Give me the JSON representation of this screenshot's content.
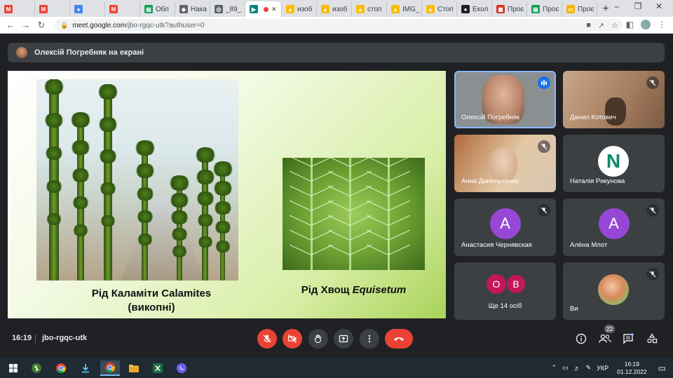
{
  "browser": {
    "tabs": [
      {
        "label": "",
        "favicon": "gmail-icon",
        "color": "#ea4335"
      },
      {
        "label": "",
        "favicon": "gmail-icon",
        "color": "#ea4335"
      },
      {
        "label": "",
        "favicon": "chrome-icon",
        "color": "#4285f4"
      },
      {
        "label": "",
        "favicon": "gmail-icon",
        "color": "#ea4335"
      },
      {
        "label": "Обл",
        "favicon": "sheets-icon",
        "color": "#0f9d58"
      },
      {
        "label": "Нака",
        "favicon": "shield-icon",
        "color": "#5f6368"
      },
      {
        "label": "_89_",
        "favicon": "globe-icon",
        "color": "#5f6368"
      },
      {
        "label": "",
        "favicon": "meet-icon",
        "color": "#00897b"
      },
      {
        "label": "изоб",
        "favicon": "drive-icon",
        "color": "#fbbc04"
      },
      {
        "label": "изоб",
        "favicon": "drive-icon",
        "color": "#fbbc04"
      },
      {
        "label": "стоп",
        "favicon": "drive-icon",
        "color": "#fbbc04"
      },
      {
        "label": "IMG_",
        "favicon": "drive-icon",
        "color": "#fbbc04"
      },
      {
        "label": "Стоп",
        "favicon": "drive-icon",
        "color": "#fbbc04"
      },
      {
        "label": "Екол",
        "favicon": "app-icon",
        "color": "#202124"
      },
      {
        "label": "Проє",
        "favicon": "forms-icon",
        "color": "#d93025"
      },
      {
        "label": "Проє",
        "favicon": "sheets-icon",
        "color": "#0f9d58"
      },
      {
        "label": "Проє",
        "favicon": "slides-icon",
        "color": "#f4b400"
      }
    ],
    "url_host": "meet.google.com",
    "url_path": "/jbo-rgqc-utk?authuser=0"
  },
  "presenter_bar": {
    "text": "Олексій Погребняк на екрані"
  },
  "slide": {
    "caption_left_line1": "Рід Каламіти Calamites",
    "caption_left_line2": "(викопні)",
    "caption_right_prefix": "Рід Хвощ ",
    "caption_right_latin": "Equisetum"
  },
  "participants": [
    {
      "name": "Олексій Погребняк",
      "type": "video",
      "speaking": true
    },
    {
      "name": "Данил Котович",
      "type": "video",
      "muted": true
    },
    {
      "name": "Анна Данильченко",
      "type": "video",
      "muted": true
    },
    {
      "name": "Наталія Рикунова",
      "type": "logo",
      "logo_letter": "N"
    },
    {
      "name": "Анастасия Чернявская",
      "type": "avatar",
      "letter": "A",
      "muted": true
    },
    {
      "name": "Алёна Млот",
      "type": "avatar",
      "letter": "A",
      "muted": true
    },
    {
      "name": "Ще 14 осіб",
      "type": "more",
      "letters": [
        "O",
        "B"
      ]
    },
    {
      "name": "Ви",
      "type": "photo",
      "muted": true
    }
  ],
  "meeting": {
    "time": "16:19",
    "code": "jbo-rgqc-utk",
    "participant_count": "22"
  },
  "taskbar": {
    "lang": "УКР",
    "time": "16:19",
    "date": "01.12.2022"
  },
  "colors": {
    "accent": "#8ab4f8",
    "danger": "#ea4335",
    "avatar_purple": "#9747d6",
    "avatar_red": "#c2185b"
  }
}
